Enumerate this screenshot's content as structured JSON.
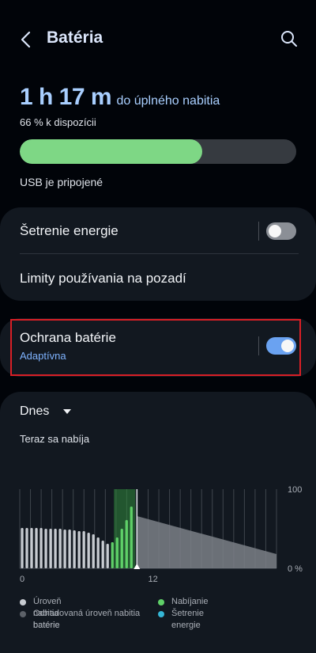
{
  "header": {
    "title": "Batéria"
  },
  "summary": {
    "time_value": "1 h 17 m",
    "time_suffix": "do úplného nabitia",
    "available": "66 % k dispozícii",
    "battery_level_percent": 66,
    "connection": "USB je pripojené"
  },
  "settings": {
    "power_saving": {
      "label": "Šetrenie energie",
      "enabled": false
    },
    "background_limits": {
      "label": "Limity používania na pozadí"
    }
  },
  "protection": {
    "label": "Ochrana batérie",
    "mode": "Adaptívna",
    "enabled": true
  },
  "usage": {
    "period": "Dnes",
    "status": "Teraz sa nabíja",
    "legend": [
      {
        "label": "Úroveň nabitia batérie",
        "color": "#c7cbd1"
      },
      {
        "label": "Nabíjanie",
        "color": "#5fd068"
      },
      {
        "label": "Odhadovaná úroveň nabitia batérie",
        "color": "#5c6168"
      },
      {
        "label": "Šetrenie energie",
        "color": "#35b6d6"
      }
    ]
  },
  "chart_data": {
    "type": "bar",
    "x_tick_labels": [
      "0",
      "12"
    ],
    "y_tick_labels": [
      "100",
      "0 %"
    ],
    "ylim": [
      0,
      100
    ],
    "grid": true,
    "bars_level": [
      51,
      51,
      51,
      51,
      51,
      50,
      50,
      50,
      50,
      49,
      49,
      48,
      47,
      47,
      45,
      43,
      39,
      35,
      31
    ],
    "bars_charging": [
      33,
      39,
      50,
      61,
      78
    ],
    "estimated_line": {
      "from": 66,
      "to": 18
    }
  }
}
